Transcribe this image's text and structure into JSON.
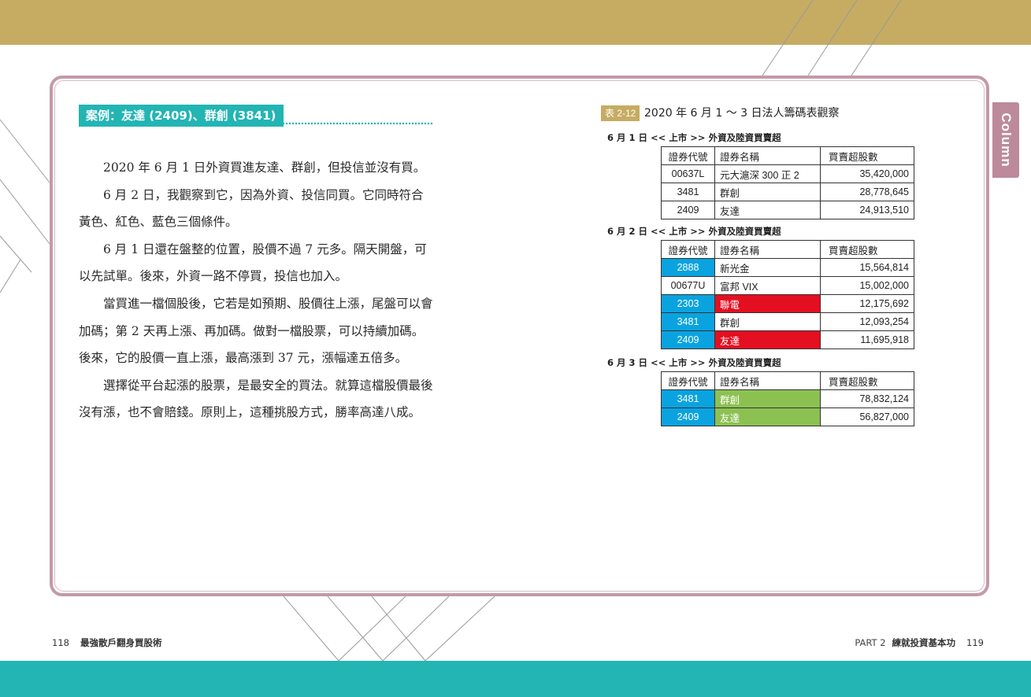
{
  "case_title": "案例：友達 (2409)、群創 (3841)",
  "paragraphs": [
    "2020 年 6 月 1 日外資買進友達、群創，但投信並沒有買。",
    "6 月 2 日，我觀察到它，因為外資、投信同買。它同時符合黃色、紅色、藍色三個條件。",
    "6 月 1 日還在盤整的位置，股價不過 7 元多。隔天開盤，可以先試單。後來，外資一路不停買，投信也加入。",
    "當買進一檔個股後，它若是如預期、股價往上漲，尾盤可以會加碼；第 2 天再上漲、再加碼。做對一檔股票，可以持續加碼。後來，它的股價一直上漲，最高漲到 37 元，漲幅達五倍多。",
    "選擇從平台起漲的股票，是最安全的買法。就算這檔股價最後沒有漲，也不會賠錢。原則上，這種挑股方式，勝率高達八成。"
  ],
  "side_tab": "Column",
  "figure": {
    "label": "表 2-12",
    "title": "2020 年 6 月 1 ～ 3 日法人籌碼表觀察",
    "headers": [
      "證券代號",
      "證券名稱",
      "買賣超股數"
    ],
    "colors": {
      "blue": "#0aa3e0",
      "red": "#e40f21",
      "green": "#8cc152"
    },
    "tables": [
      {
        "subtitle": "6 月 1 日 << 上市 >> 外資及陸資買賣超",
        "rows": [
          {
            "code": "00637L",
            "name": "元大滬深 300 正 2",
            "shares": "35,420,000",
            "code_hl": "",
            "name_hl": ""
          },
          {
            "code": "3481",
            "name": "群創",
            "shares": "28,778,645",
            "code_hl": "",
            "name_hl": ""
          },
          {
            "code": "2409",
            "name": "友達",
            "shares": "24,913,510",
            "code_hl": "",
            "name_hl": ""
          }
        ]
      },
      {
        "subtitle": "6 月 2 日 << 上市 >> 外資及陸資買賣超",
        "rows": [
          {
            "code": "2888",
            "name": "新光金",
            "shares": "15,564,814",
            "code_hl": "blue",
            "name_hl": ""
          },
          {
            "code": "00677U",
            "name": "富邦 VIX",
            "shares": "15,002,000",
            "code_hl": "",
            "name_hl": ""
          },
          {
            "code": "2303",
            "name": "聯電",
            "shares": "12,175,692",
            "code_hl": "blue",
            "name_hl": "red"
          },
          {
            "code": "3481",
            "name": "群創",
            "shares": "12,093,254",
            "code_hl": "blue",
            "name_hl": ""
          },
          {
            "code": "2409",
            "name": "友達",
            "shares": "11,695,918",
            "code_hl": "blue",
            "name_hl": "red"
          }
        ]
      },
      {
        "subtitle": "6 月 3 日 << 上市 >> 外資及陸資買賣超",
        "rows": [
          {
            "code": "3481",
            "name": "群創",
            "shares": "78,832,124",
            "code_hl": "blue",
            "name_hl": "green"
          },
          {
            "code": "2409",
            "name": "友達",
            "shares": "56,827,000",
            "code_hl": "blue",
            "name_hl": "green"
          }
        ]
      }
    ]
  },
  "footer": {
    "left_page": "118",
    "left_book": "最強散戶翻身買股術",
    "right_part": "PART 2",
    "right_chapter": "練就投資基本功",
    "right_page": "119"
  }
}
